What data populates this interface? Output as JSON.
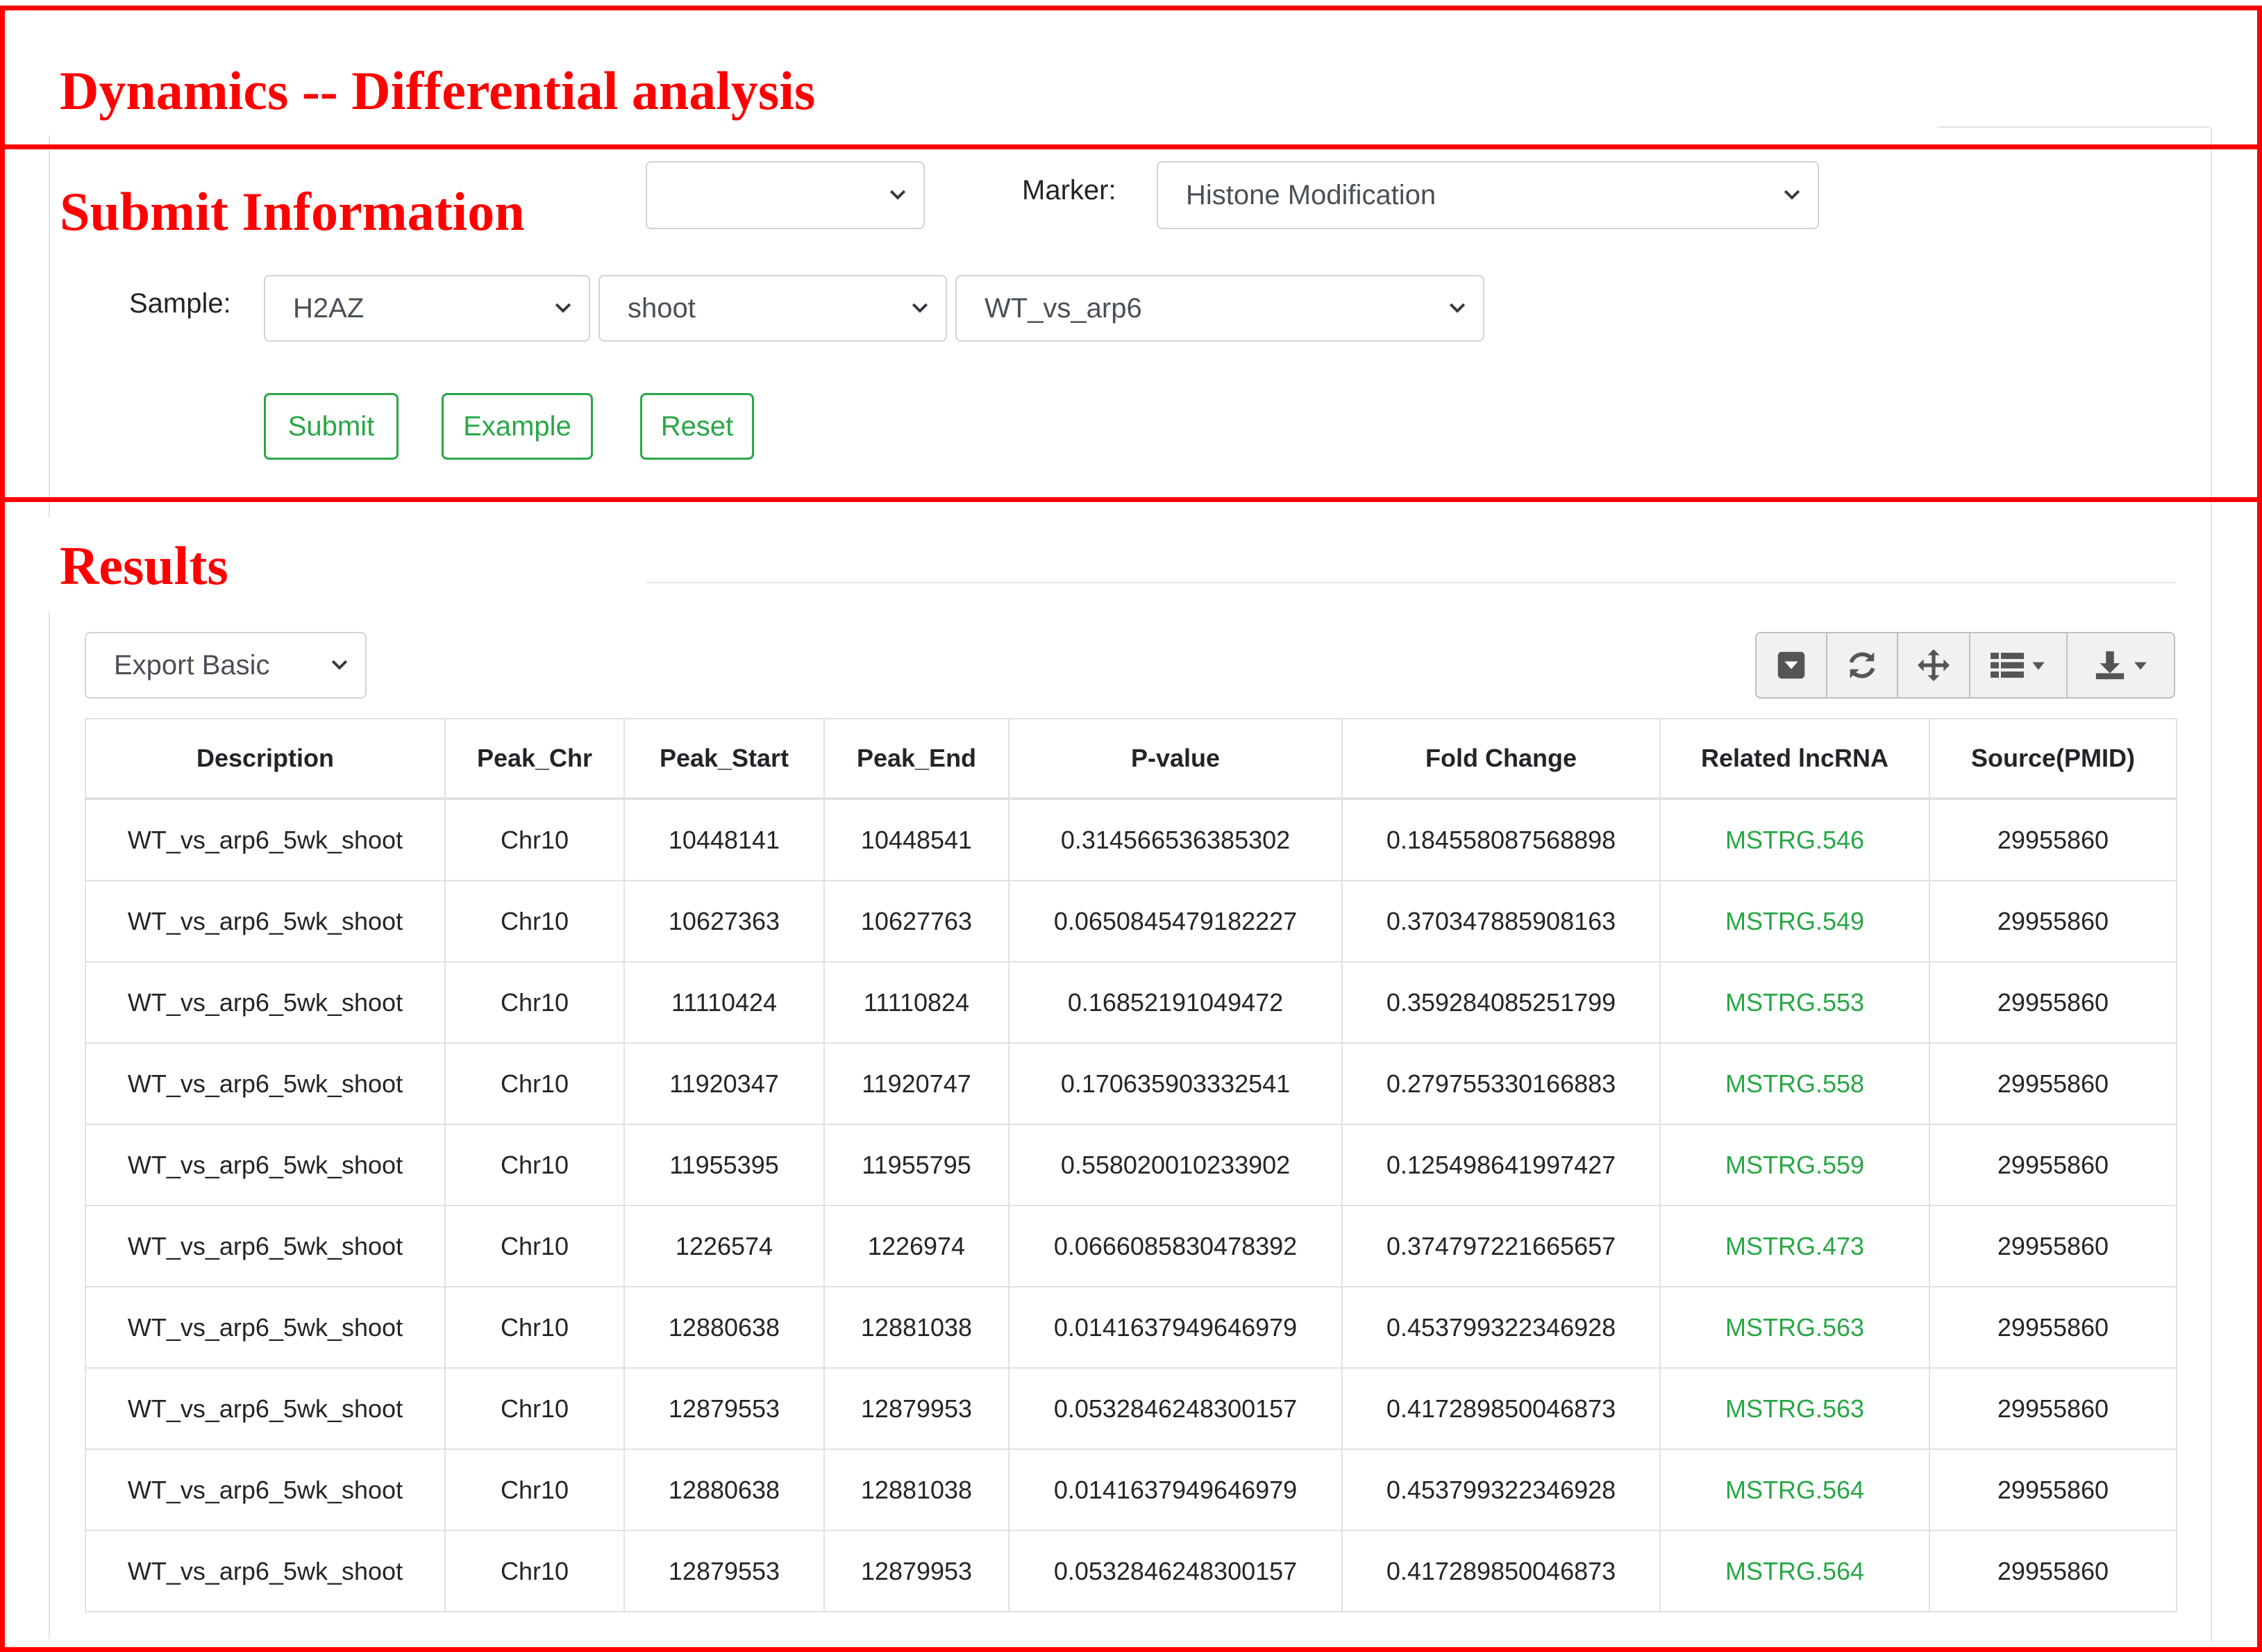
{
  "annotations": {
    "header_title": "Dynamics -- Differential analysis",
    "submit_title": "Submit Information",
    "results_title": "Results"
  },
  "form": {
    "marker_label": "Marker:",
    "marker_value": "Histone Modification",
    "sample_label": "Sample:",
    "sample_values": [
      "H2AZ",
      "shoot",
      "WT_vs_arp6"
    ],
    "submit_label": "Submit",
    "example_label": "Example",
    "reset_label": "Reset"
  },
  "results": {
    "export_value": "Export Basic",
    "toolbar_icons": [
      "collapse-icon",
      "refresh-icon",
      "move-icon",
      "columns-icon",
      "download-icon"
    ],
    "columns": [
      "Description",
      "Peak_Chr",
      "Peak_Start",
      "Peak_End",
      "P-value",
      "Fold Change",
      "Related lncRNA",
      "Source(PMID)"
    ],
    "rows": [
      [
        "WT_vs_arp6_5wk_shoot",
        "Chr10",
        "10448141",
        "10448541",
        "0.314566536385302",
        "0.184558087568898",
        "MSTRG.546",
        "29955860"
      ],
      [
        "WT_vs_arp6_5wk_shoot",
        "Chr10",
        "10627363",
        "10627763",
        "0.0650845479182227",
        "0.370347885908163",
        "MSTRG.549",
        "29955860"
      ],
      [
        "WT_vs_arp6_5wk_shoot",
        "Chr10",
        "11110424",
        "11110824",
        "0.16852191049472",
        "0.359284085251799",
        "MSTRG.553",
        "29955860"
      ],
      [
        "WT_vs_arp6_5wk_shoot",
        "Chr10",
        "11920347",
        "11920747",
        "0.170635903332541",
        "0.279755330166883",
        "MSTRG.558",
        "29955860"
      ],
      [
        "WT_vs_arp6_5wk_shoot",
        "Chr10",
        "11955395",
        "11955795",
        "0.558020010233902",
        "0.125498641997427",
        "MSTRG.559",
        "29955860"
      ],
      [
        "WT_vs_arp6_5wk_shoot",
        "Chr10",
        "1226574",
        "1226974",
        "0.0666085830478392",
        "0.374797221665657",
        "MSTRG.473",
        "29955860"
      ],
      [
        "WT_vs_arp6_5wk_shoot",
        "Chr10",
        "12880638",
        "12881038",
        "0.0141637949646979",
        "0.453799322346928",
        "MSTRG.563",
        "29955860"
      ],
      [
        "WT_vs_arp6_5wk_shoot",
        "Chr10",
        "12879553",
        "12879953",
        "0.0532846248300157",
        "0.417289850046873",
        "MSTRG.563",
        "29955860"
      ],
      [
        "WT_vs_arp6_5wk_shoot",
        "Chr10",
        "12880638",
        "12881038",
        "0.0141637949646979",
        "0.453799322346928",
        "MSTRG.564",
        "29955860"
      ],
      [
        "WT_vs_arp6_5wk_shoot",
        "Chr10",
        "12879553",
        "12879953",
        "0.0532846248300157",
        "0.417289850046873",
        "MSTRG.564",
        "29955860"
      ]
    ]
  },
  "colors": {
    "annotation": "#ff0000",
    "accent": "#28a745"
  }
}
